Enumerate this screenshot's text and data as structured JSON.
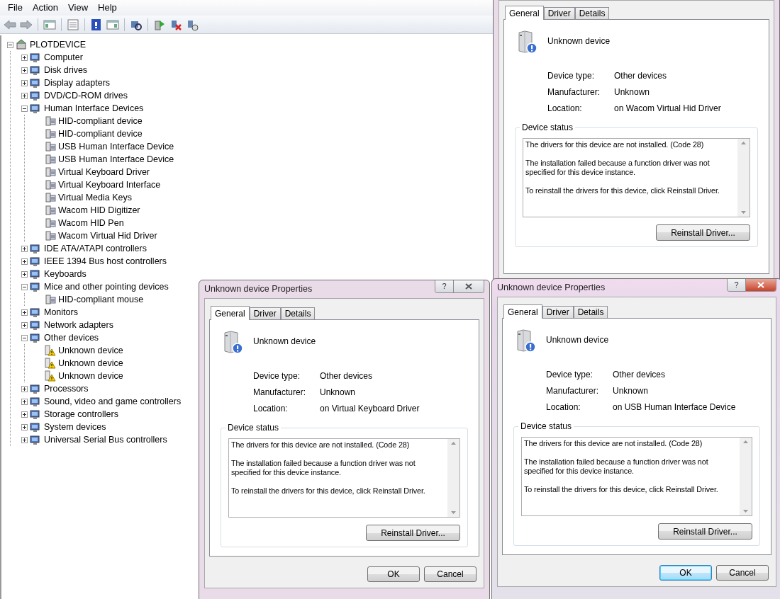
{
  "menu": [
    "File",
    "Action",
    "View",
    "Help"
  ],
  "tree": {
    "label": "PLOTDEVICE",
    "expanded": true,
    "children": [
      {
        "label": "Computer",
        "expanded": false
      },
      {
        "label": "Disk drives",
        "expanded": false
      },
      {
        "label": "Display adapters",
        "expanded": false
      },
      {
        "label": "DVD/CD-ROM drives",
        "expanded": false
      },
      {
        "label": "Human Interface Devices",
        "expanded": true,
        "children": [
          {
            "label": "HID-compliant device",
            "warning": false
          },
          {
            "label": "HID-compliant device",
            "warning": false
          },
          {
            "label": "USB Human Interface Device",
            "warning": false
          },
          {
            "label": "USB Human Interface Device",
            "warning": false
          },
          {
            "label": "Virtual Keyboard Driver",
            "warning": false
          },
          {
            "label": "Virtual Keyboard Interface",
            "warning": false
          },
          {
            "label": "Virtual Media Keys",
            "warning": false
          },
          {
            "label": "Wacom HID Digitizer",
            "warning": false
          },
          {
            "label": "Wacom HID Pen",
            "warning": false
          },
          {
            "label": "Wacom Virtual Hid Driver",
            "warning": false
          }
        ]
      },
      {
        "label": "IDE ATA/ATAPI controllers",
        "expanded": false
      },
      {
        "label": "IEEE 1394 Bus host controllers",
        "expanded": false
      },
      {
        "label": "Keyboards",
        "expanded": false
      },
      {
        "label": "Mice and other pointing devices",
        "expanded": true,
        "children": [
          {
            "label": "HID-compliant mouse",
            "warning": false
          }
        ]
      },
      {
        "label": "Monitors",
        "expanded": false
      },
      {
        "label": "Network adapters",
        "expanded": false
      },
      {
        "label": "Other devices",
        "expanded": true,
        "children": [
          {
            "label": "Unknown device",
            "warning": true
          },
          {
            "label": "Unknown device",
            "warning": true
          },
          {
            "label": "Unknown device",
            "warning": true
          }
        ]
      },
      {
        "label": "Processors",
        "expanded": false
      },
      {
        "label": "Sound, video and game controllers",
        "expanded": false
      },
      {
        "label": "Storage controllers",
        "expanded": false
      },
      {
        "label": "System devices",
        "expanded": false
      },
      {
        "label": "Universal Serial Bus controllers",
        "expanded": false
      }
    ]
  },
  "dialogs": [
    {
      "tabs": [
        {
          "label": "General",
          "selected": true
        },
        {
          "label": "Driver",
          "selected": false
        },
        {
          "label": "Details",
          "selected": false
        }
      ],
      "device_name": "Unknown device",
      "properties": [
        {
          "label": "Device type:",
          "value": "Other devices"
        },
        {
          "label": "Manufacturer:",
          "value": "Unknown"
        },
        {
          "label": "Location:",
          "value": "on Wacom Virtual Hid Driver"
        }
      ],
      "status_title": "Device status",
      "status_text": [
        "The drivers for this device are not installed. (Code 28)",
        "The installation failed because a function driver was not specified for this device instance.",
        "To reinstall the drivers for this device, click Reinstall Driver."
      ],
      "reinstall_button": "Reinstall Driver..."
    },
    {
      "title": "Unknown device Properties",
      "active": false,
      "help_button": "?",
      "tabs": [
        {
          "label": "General",
          "selected": true
        },
        {
          "label": "Driver",
          "selected": false
        },
        {
          "label": "Details",
          "selected": false
        }
      ],
      "device_name": "Unknown device",
      "properties": [
        {
          "label": "Device type:",
          "value": "Other devices"
        },
        {
          "label": "Manufacturer:",
          "value": "Unknown"
        },
        {
          "label": "Location:",
          "value": "on Virtual Keyboard Driver"
        }
      ],
      "status_title": "Device status",
      "status_text": [
        "The drivers for this device are not installed. (Code 28)",
        "The installation failed because a function driver was not specified for this device instance.",
        "To reinstall the drivers for this device, click Reinstall Driver."
      ],
      "reinstall_button": "Reinstall Driver...",
      "footer_buttons": [
        {
          "label": "OK",
          "default": false
        },
        {
          "label": "Cancel",
          "default": false
        }
      ]
    },
    {
      "title": "Unknown device Properties",
      "active": true,
      "help_button": "?",
      "tabs": [
        {
          "label": "General",
          "selected": true
        },
        {
          "label": "Driver",
          "selected": false
        },
        {
          "label": "Details",
          "selected": false
        }
      ],
      "device_name": "Unknown device",
      "properties": [
        {
          "label": "Device type:",
          "value": "Other devices"
        },
        {
          "label": "Manufacturer:",
          "value": "Unknown"
        },
        {
          "label": "Location:",
          "value": "on USB Human Interface Device"
        }
      ],
      "status_title": "Device status",
      "status_text": [
        "The drivers for this device are not installed. (Code 28)",
        "The installation failed because a function driver was not specified for this device instance.",
        "To reinstall the drivers for this device, click Reinstall Driver."
      ],
      "reinstall_button": "Reinstall Driver...",
      "footer_buttons": [
        {
          "label": "OK",
          "default": true
        },
        {
          "label": "Cancel",
          "default": false
        }
      ]
    }
  ]
}
